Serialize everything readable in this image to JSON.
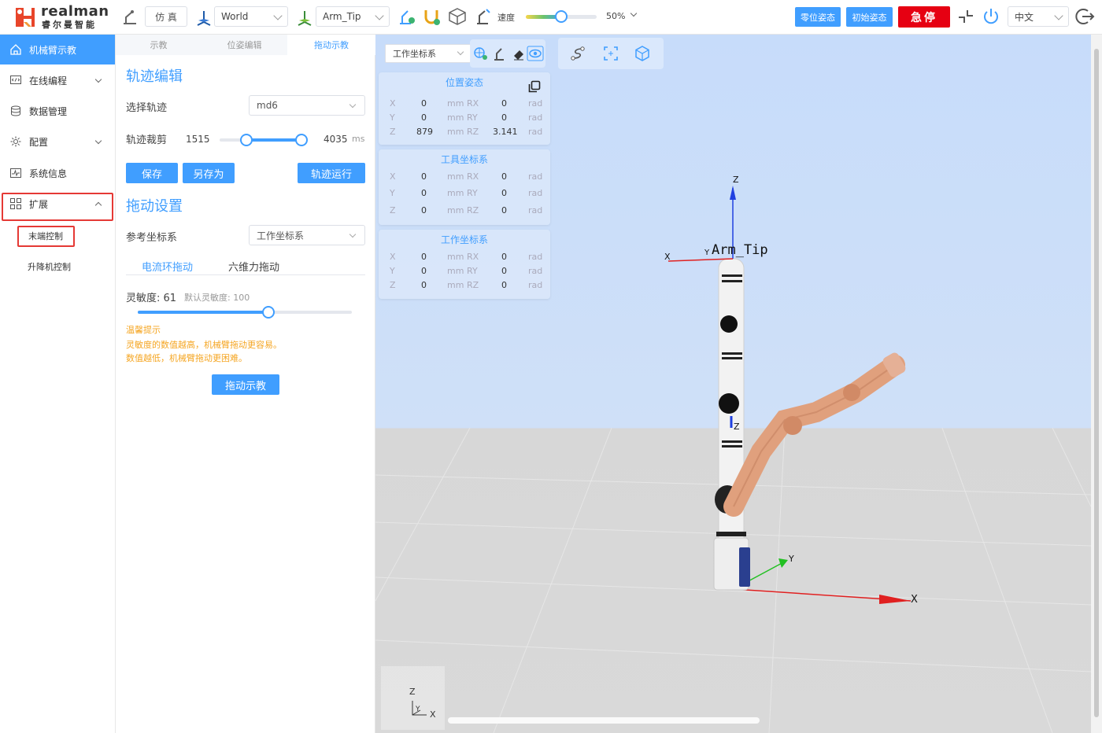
{
  "topbar": {
    "brand": "realman",
    "brand_cn": "睿尔曼智能",
    "sim_label": "仿 真",
    "world_select": "World",
    "tool_select": "Arm_Tip",
    "speed_label": "速度",
    "speed_percent": 50,
    "speed_text": "50%",
    "zero_pose": "零位姿态",
    "init_pose": "初始姿态",
    "estop": "急停",
    "language": "中文",
    "colors": {
      "accent": "#409eff",
      "estop": "#e60012"
    }
  },
  "sidebar": {
    "items": [
      {
        "label": "机械臂示教",
        "icon": "home-icon",
        "active": true
      },
      {
        "label": "在线编程",
        "icon": "code-icon",
        "expandable": true
      },
      {
        "label": "数据管理",
        "icon": "database-icon"
      },
      {
        "label": "配置",
        "icon": "settings-icon",
        "expandable": true
      },
      {
        "label": "系统信息",
        "icon": "monitor-icon"
      },
      {
        "label": "扩展",
        "icon": "apps-icon",
        "expandable": true,
        "expanded": true
      }
    ],
    "sub_items": [
      "末端控制",
      "升降机控制"
    ]
  },
  "panel": {
    "tabs": [
      "示教",
      "位姿编辑",
      "拖动示教"
    ],
    "active_tab": 2,
    "trajectory_title": "轨迹编辑",
    "select_label": "选择轨迹",
    "select_value": "md6",
    "clip_label": "轨迹裁剪",
    "clip_start": "1515",
    "clip_end": "4035",
    "clip_unit": "ms",
    "clip_start_fraction": 0.5,
    "clip_end_fraction": 1.0,
    "save": "保存",
    "save_as": "另存为",
    "run": "轨迹运行",
    "drag_title": "拖动设置",
    "ref_label": "参考坐标系",
    "ref_value": "工作坐标系",
    "subtabs": [
      "电流环拖动",
      "六维力拖动"
    ],
    "sensitivity_label": "灵敏度: 61",
    "sensitivity_default": "默认灵敏度: 100",
    "sensitivity_value": 61,
    "tip_title": "温馨提示",
    "tip_line1": "灵敏度的数值越高，机械臂拖动更容易。",
    "tip_line2": "数值越低，机械臂拖动更困难。",
    "drag_teach_button": "拖动示教"
  },
  "viewport": {
    "frame_select": "工作坐标系",
    "robot_label": "Arm_Tip",
    "cards": [
      {
        "title": "位置姿态",
        "rows": [
          {
            "axis": "X",
            "val": "0",
            "unit": "mm",
            "raxis": "RX",
            "rval": "0",
            "runit": "rad"
          },
          {
            "axis": "Y",
            "val": "0",
            "unit": "mm",
            "raxis": "RY",
            "rval": "0",
            "runit": "rad"
          },
          {
            "axis": "Z",
            "val": "879",
            "unit": "mm",
            "raxis": "RZ",
            "rval": "3.141",
            "runit": "rad"
          }
        ]
      },
      {
        "title": "工具坐标系",
        "rows": [
          {
            "axis": "X",
            "val": "0",
            "unit": "mm",
            "raxis": "RX",
            "rval": "0",
            "runit": "rad"
          },
          {
            "axis": "Y",
            "val": "0",
            "unit": "mm",
            "raxis": "RY",
            "rval": "0",
            "runit": "rad"
          },
          {
            "axis": "Z",
            "val": "0",
            "unit": "mm",
            "raxis": "RZ",
            "rval": "0",
            "runit": "rad"
          }
        ]
      },
      {
        "title": "工作坐标系",
        "rows": [
          {
            "axis": "X",
            "val": "0",
            "unit": "mm",
            "raxis": "RX",
            "rval": "0",
            "runit": "rad"
          },
          {
            "axis": "Y",
            "val": "0",
            "unit": "mm",
            "raxis": "RY",
            "rval": "0",
            "runit": "rad"
          },
          {
            "axis": "Z",
            "val": "0",
            "unit": "mm",
            "raxis": "RZ",
            "rval": "0",
            "runit": "rad"
          }
        ]
      }
    ],
    "axes": {
      "x": "X",
      "y": "Y",
      "z": "Z"
    }
  }
}
